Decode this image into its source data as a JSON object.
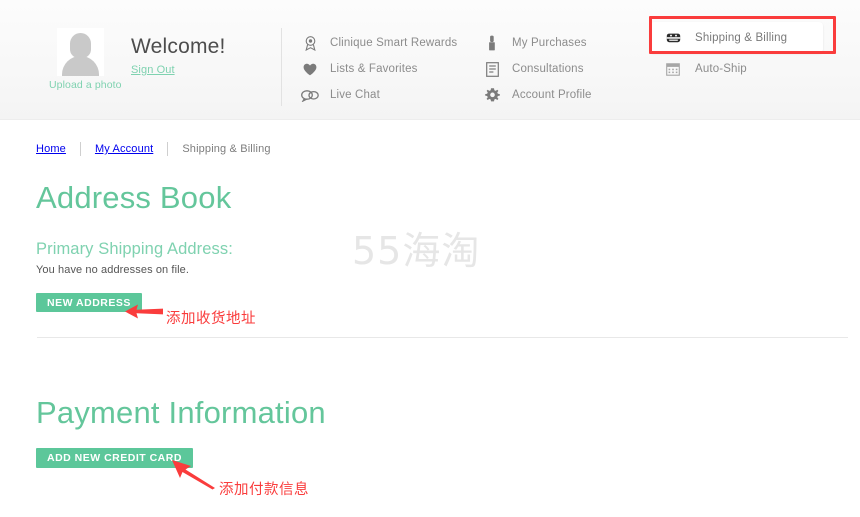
{
  "header": {
    "avatar_alt": "user-avatar-placeholder",
    "upload_photo_label": "Upload a photo",
    "welcome_title": "Welcome!",
    "sign_out_label": "Sign Out",
    "nav_columns": [
      {
        "items": [
          {
            "icon": "award-ribbon-icon",
            "label": "Clinique Smart Rewards"
          },
          {
            "icon": "heart-icon",
            "label": "Lists & Favorites"
          },
          {
            "icon": "chat-bubbles-icon",
            "label": "Live Chat"
          }
        ]
      },
      {
        "items": [
          {
            "icon": "lipstick-icon",
            "label": "My Purchases"
          },
          {
            "icon": "document-icon",
            "label": "Consultations"
          },
          {
            "icon": "gear-icon",
            "label": "Account Profile"
          }
        ]
      },
      {
        "items": [
          {
            "icon": "truck-shipping-icon",
            "label": "Shipping & Billing",
            "active": true
          },
          {
            "icon": "calendar-icon",
            "label": "Auto-Ship",
            "active": false
          }
        ]
      }
    ]
  },
  "breadcrumb": {
    "items": [
      "Home",
      "My Account",
      "Shipping & Billing"
    ]
  },
  "main": {
    "address_book": {
      "heading": "Address Book",
      "subheading": "Primary Shipping Address:",
      "empty_message": "You have no addresses on file.",
      "new_address_button": "NEW ADDRESS"
    },
    "payment": {
      "heading": "Payment Information",
      "add_card_button": "ADD NEW CREDIT CARD"
    }
  },
  "annotations": [
    {
      "name": "add-shipping-address-note",
      "text": "添加收货地址"
    },
    {
      "name": "add-payment-info-note",
      "text": "添加付款信息"
    }
  ],
  "watermark": {
    "text": "55海淘"
  },
  "colors": {
    "brand_green": "#64c69b",
    "button_green": "#5cc79a",
    "sub_green": "#7fd2b0",
    "annotation_red": "#fa3c3c",
    "highlight_red": "#fa3c3c",
    "text_gray": "#8c8c8c"
  }
}
